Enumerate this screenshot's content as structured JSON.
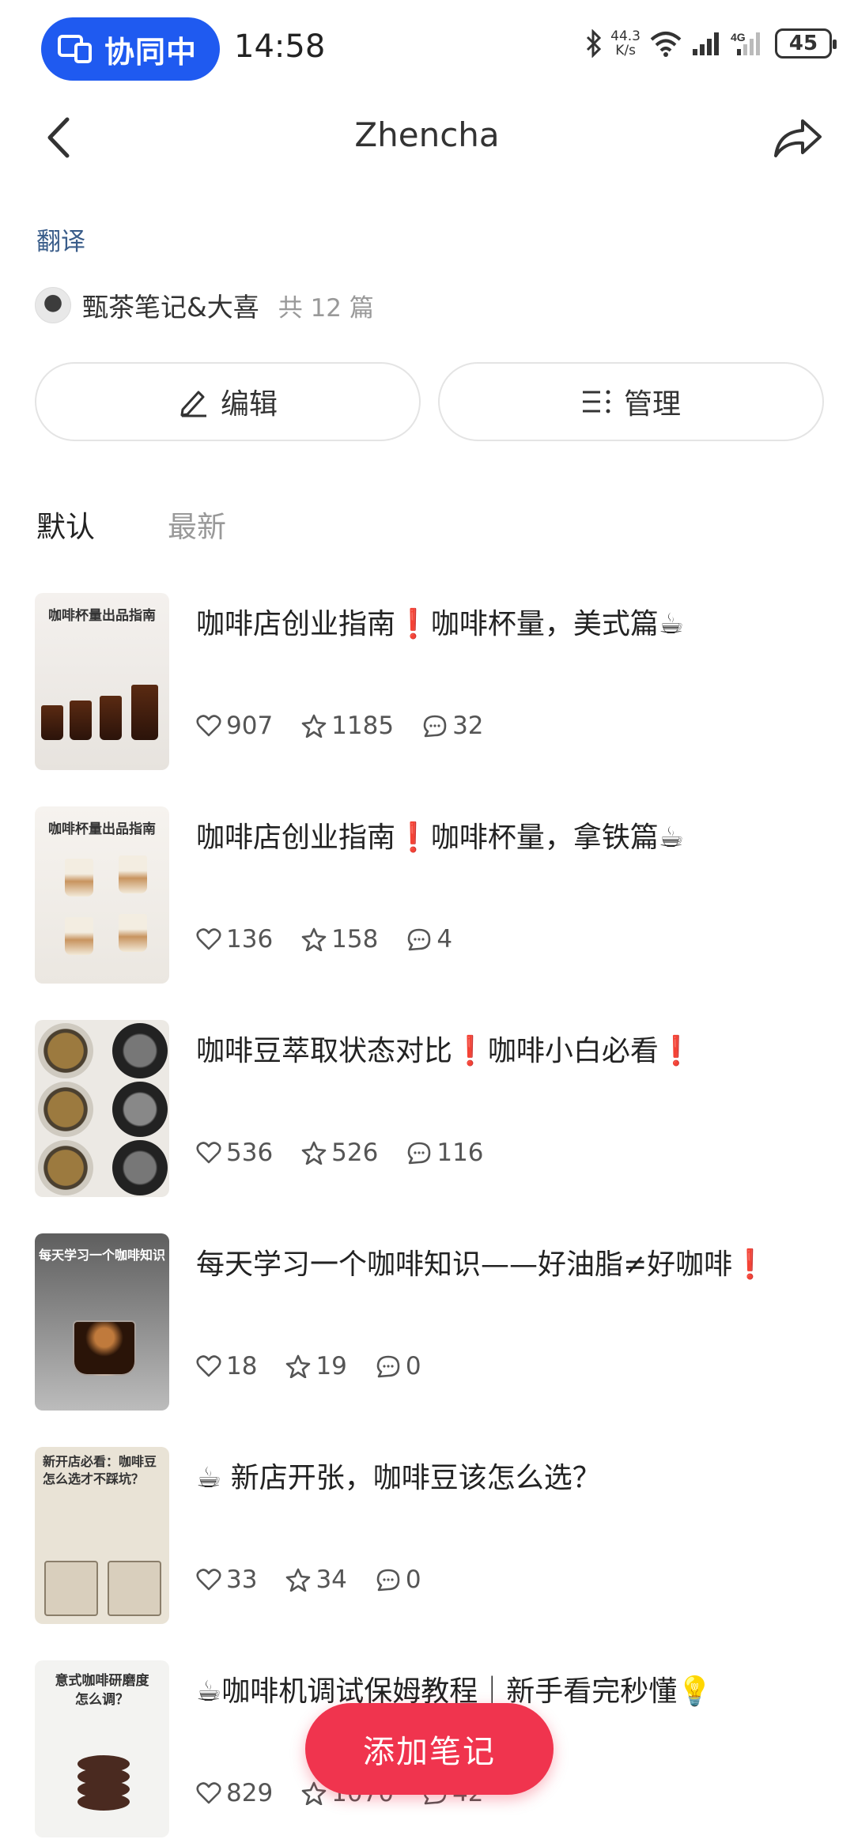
{
  "status_bar": {
    "collab_label": "协同中",
    "time": "14:58",
    "net_speed_value": "44.3",
    "net_speed_unit": "K/s",
    "battery": "45"
  },
  "header": {
    "title": "Zhencha"
  },
  "translate_label": "翻译",
  "author": {
    "name": "甄茶笔记&大喜",
    "count": "共 12 篇"
  },
  "actions": {
    "edit_label": "编辑",
    "manage_label": "管理"
  },
  "tabs": [
    {
      "label": "默认",
      "active": true
    },
    {
      "label": "最新",
      "active": false
    }
  ],
  "notes": [
    {
      "title": "咖啡店创业指南❗咖啡杯量，美式篇☕",
      "likes": "907",
      "collects": "1185",
      "comments": "32",
      "thumb_caption": "咖啡杯量出品指南"
    },
    {
      "title": "咖啡店创业指南❗咖啡杯量，拿铁篇☕",
      "likes": "136",
      "collects": "158",
      "comments": "4",
      "thumb_caption": "咖啡杯量出品指南"
    },
    {
      "title": "咖啡豆萃取状态对比❗咖啡小白必看❗",
      "likes": "536",
      "collects": "526",
      "comments": "116",
      "thumb_caption": ""
    },
    {
      "title": "每天学习一个咖啡知识——好油脂≠好咖啡❗",
      "likes": "18",
      "collects": "19",
      "comments": "0",
      "thumb_caption": "每天学习一个咖啡知识"
    },
    {
      "title": "☕ 新店开张，咖啡豆该怎么选？",
      "likes": "33",
      "collects": "34",
      "comments": "0",
      "thumb_caption": "新开店必看：咖啡豆怎么选才不踩坑？"
    },
    {
      "title": "☕咖啡机调试保姆教程｜新手看完秒懂💡",
      "likes": "829",
      "collects": "1070",
      "comments": "42",
      "thumb_caption": "意式咖啡研磨度怎么调？"
    }
  ],
  "add_note_label": "添加笔记"
}
